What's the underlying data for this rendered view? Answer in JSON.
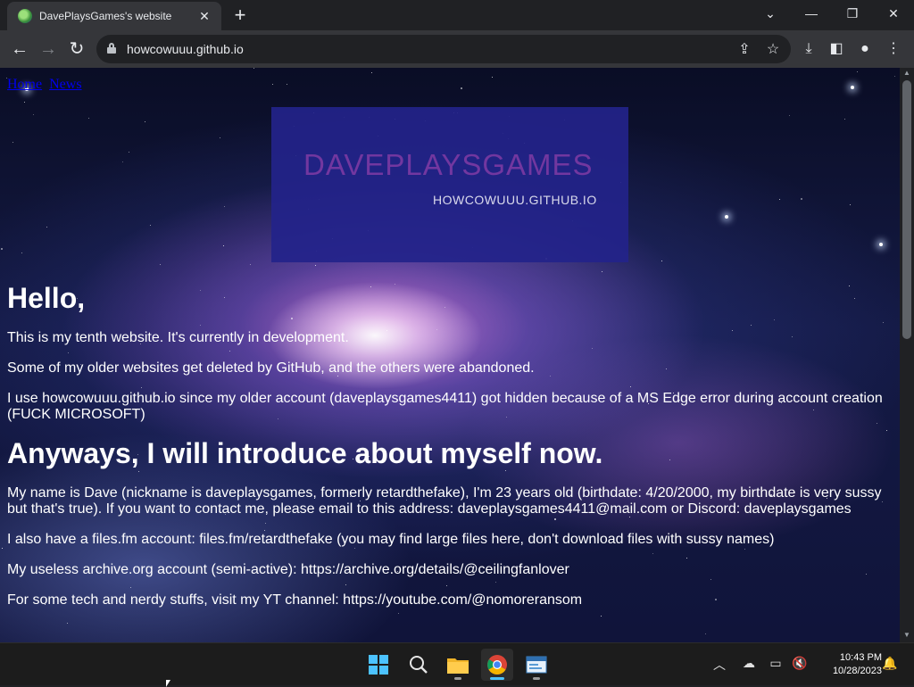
{
  "browser": {
    "tab_title": "DavePlaysGames's website",
    "tab_close": "✕",
    "new_tab": "+",
    "url": "howcowuuu.github.io",
    "window_controls": {
      "dropdown": "⌄",
      "minimize": "—",
      "restore": "❐",
      "close": "✕"
    },
    "nav": {
      "back": "←",
      "forward": "→",
      "reload": "↻"
    }
  },
  "page": {
    "nav_links": [
      "Home",
      "News"
    ],
    "banner": {
      "title": "DAVEPLAYSGAMES",
      "subtitle": "HOWCOWUUU.GITHUB.IO"
    },
    "heading1": "Hello,",
    "para1": "This is my tenth website. It's currently in development.",
    "para2": "Some of my older websites get deleted by GitHub, and the others were abandoned.",
    "para3": "I use howcowuuu.github.io since my older account (daveplaysgames4411) got hidden because of a MS Edge error during account creation (FUCK MICROSOFT)",
    "heading2": "Anyways, I will introduce about myself now.",
    "para4": "My name is Dave (nickname is daveplaysgames, formerly retardthefake), I'm 23 years old (birthdate: 4/20/2000, my birthdate is very sussy but that's true). If you want to contact me, please email to this address: daveplaysgames4411@mail.com or Discord: daveplaysgames",
    "para5": "I also have a files.fm account: files.fm/retardthefake (you may find large files here, don't download files with sussy names)",
    "para6": "My useless archive.org account (semi-active): https://archive.org/details/@ceilingfanlover",
    "para7": "For some tech and nerdy stuffs, visit my YT channel: https://youtube.com/@nomoreransom"
  },
  "taskbar": {
    "apps": [
      "start-icon",
      "search-icon",
      "file-explorer-icon",
      "chrome-icon",
      "notepad-icon"
    ],
    "time": "10:43 PM",
    "date": "10/28/2023"
  },
  "colors": {
    "link": "#0000ee",
    "banner_bg": "#23238a",
    "banner_title": "#7a3aa8",
    "taskbar_accent": "#4cc2ff"
  }
}
